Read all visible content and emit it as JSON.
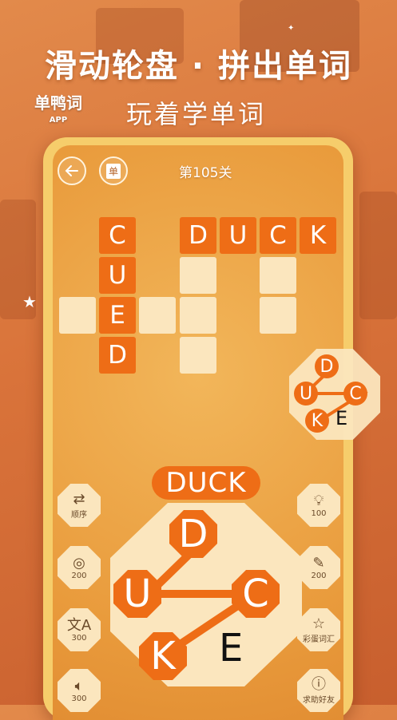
{
  "promo": {
    "title": "滑动轮盘 · 拼出单词",
    "subtitle": "玩着学单词"
  },
  "logo": {
    "text": "单鸭词",
    "sub": "APP"
  },
  "header": {
    "level": "第105关",
    "back_icon": "arrow-left",
    "dict_label": "单"
  },
  "board": {
    "words": [
      "CUED",
      "DUCK"
    ],
    "cells_filled": [
      "C",
      "U",
      "E",
      "D",
      "D",
      "U",
      "C",
      "K"
    ]
  },
  "mini_wheel": {
    "letters": [
      "D",
      "U",
      "C",
      "K",
      "E"
    ]
  },
  "current_word": "DUCK",
  "wheel": {
    "letters": [
      "D",
      "U",
      "C",
      "K",
      "E"
    ]
  },
  "left_buttons": [
    {
      "icon": "shuffle-icon",
      "label": "顺序"
    },
    {
      "icon": "target-icon",
      "label": "200"
    },
    {
      "icon": "translate-icon",
      "label": "300"
    },
    {
      "icon": "speaker-icon",
      "label": "300"
    }
  ],
  "right_buttons": [
    {
      "icon": "bulb-icon",
      "label": "100"
    },
    {
      "icon": "magic-wand-icon",
      "label": "200"
    },
    {
      "icon": "star-icon",
      "label": "彩蛋词汇"
    },
    {
      "icon": "help-icon",
      "label": "求助好友"
    }
  ],
  "colors": {
    "accent": "#ee6d16",
    "tile": "#fbe6be",
    "frame": "#f6cd6b"
  }
}
